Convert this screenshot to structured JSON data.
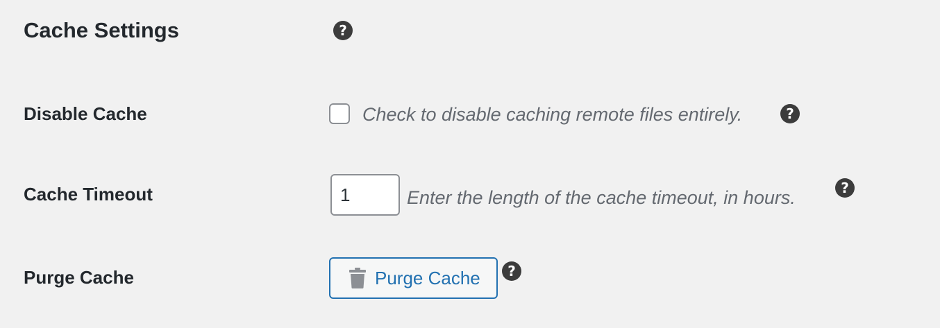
{
  "section": {
    "title": "Cache Settings",
    "help_glyph": "?"
  },
  "rows": [
    {
      "label": "Disable Cache",
      "control": "checkbox",
      "checked": false,
      "description": "Check to disable caching remote files entirely.",
      "help_glyph": "?"
    },
    {
      "label": "Cache Timeout",
      "control": "number-input",
      "value": "1",
      "description": "Enter the length of the cache timeout, in hours.",
      "help_glyph": "?"
    },
    {
      "label": "Purge Cache",
      "control": "button",
      "button_label": "Purge Cache",
      "button_icon": "trash-icon",
      "help_glyph": "?"
    }
  ],
  "colors": {
    "background": "#f1f1f1",
    "text": "#23282d",
    "description": "#646970",
    "accent": "#2271b1",
    "help_icon": "#3c3c3c"
  }
}
